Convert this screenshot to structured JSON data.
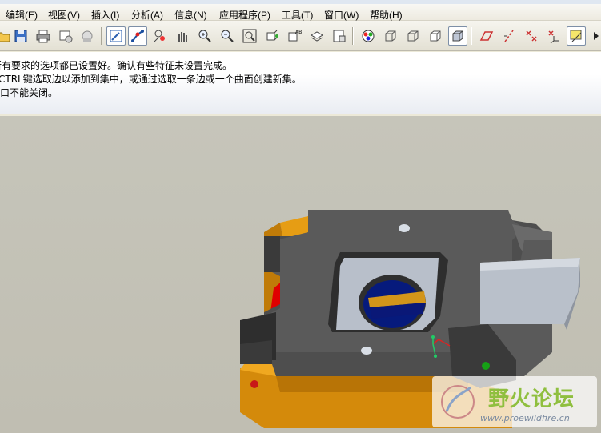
{
  "menu": [
    "编辑(E)",
    "视图(V)",
    "插入(I)",
    "分析(A)",
    "信息(N)",
    "应用程序(P)",
    "工具(T)",
    "窗口(W)",
    "帮助(H)"
  ],
  "toolbar": {
    "icons": [
      "open-folder-icon",
      "save-icon",
      "print-icon",
      "send-mail-icon",
      "sketch-icon",
      "spin-center-icon",
      "datum-icon",
      "zoom-icon",
      "pan-icon",
      "zoom-in-icon",
      "zoom-out-icon",
      "refit-icon",
      "reorient-icon",
      "saved-views-icon",
      "layers-icon",
      "model-tree-icon",
      "appearance-icon",
      "wireframe-icon",
      "hidden-line-icon",
      "no-hidden-icon",
      "shading-icon",
      "datum-planes-icon",
      "datum-axes-icon",
      "datum-points-icon",
      "coordinate-systems-icon",
      "annotation-display-icon",
      "scroll-right-icon"
    ]
  },
  "messages": [
    "所有要求的选项都已设置好。确认有些特征未设置完成。",
    "CTRL键选取边以添加到集中，或通过选取一条边或一个曲面创建新集。",
    "窗口不能关闭。"
  ],
  "watermark": {
    "title": "野火论坛",
    "url": "www.proewildfire.cn"
  },
  "colors": {
    "body": "#4a4a4a",
    "orange": "#e39a12",
    "light_gray": "#b8bfca",
    "blue": "#0a1877"
  }
}
